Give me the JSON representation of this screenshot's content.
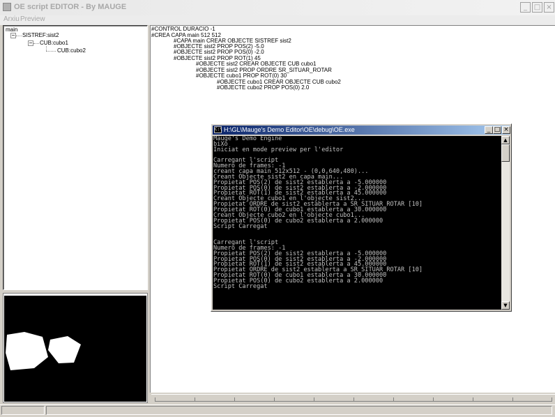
{
  "window": {
    "title": "OE script EDITOR - By MAUGE",
    "minimize_icon": "_",
    "maximize_icon": "□",
    "close_icon": "×"
  },
  "menu": [
    {
      "label": "Arxiu"
    },
    {
      "label": "Preview"
    }
  ],
  "tree": {
    "root": "main",
    "items": [
      {
        "label": "SISTREF:sist2",
        "expander": "−"
      },
      {
        "label": "CUB:cubo1",
        "expander": "−"
      },
      {
        "label": "CUB:cubo2"
      }
    ]
  },
  "editor": {
    "lines": [
      "#CONTROL DURACIO -1",
      "#CREA CAPA main 512 512",
      "#CAPA main CREAR OBJECTE SISTREF sist2",
      "#OBJECTE sist2 PROP POS(2) -5.0",
      "#OBJECTE sist2 PROP POS(0) -2.0",
      "#OBJECTE sist2 PROP ROT(1) 45",
      "#OBJECTE sist2 CREAR OBJECTE CUB cubo1",
      "#OBJECTE sist2 PROP ORDRE SR_SITUAR_ROTAR",
      "#OBJECTE cubo1 PROP ROT(0) 30",
      "#OBJECTE cubo1 CREAR OBJECTE CUB cubo2",
      "#OBJECTE cubo2 PROP POS(0) 2.0"
    ]
  },
  "console": {
    "title": "H:\\GL\\Mauge's Demo Editor\\OE\\debug\\OE.exe",
    "icon_label": "C:\\",
    "minimize_icon": "_",
    "maximize_icon": "□",
    "close_icon": "×",
    "scroll_up_icon": "▲",
    "scroll_down_icon": "▼",
    "lines": [
      "Mauge's Demo Engine",
      "biXo",
      "Iniciat en mode preview per l'editor",
      "",
      "Carregant l'script",
      "Numero de frames: -1",
      "creant capa main 512x512 - (0,0,640,480)...",
      "Creant Objecte sist2 en capa main...",
      "Propietat POS(2) de sist2 establerta a -5.000000",
      "Propietat POS(0) de sist2 establerta a -2.000000",
      "Propietat ROT(1) de sist2 establerta a 45.000000",
      "Creant Objecte cubo1 en l'objecte sist2...",
      "Propietat ORDRE de sist2 establerta a SR_SITUAR_ROTAR [10]",
      "Propietat ROT(0) de cubo1 establerta a 30.000000",
      "Creant Objecte cubo2 en l'objecte cubo1...",
      "Propietat POS(0) de cubo2 establerta a 2.000000",
      "Script Carregat",
      "",
      "",
      "Carregant l'script",
      "Numero de frames: -1",
      "Propietat POS(2) de sist2 establerta a -5.000000",
      "Propietat POS(0) de sist2 establerta a -2.000000",
      "Propietat ROT(1) de sist2 establerta a 45.000000",
      "Propietat ORDRE de sist2 establerta a SR_SITUAR_ROTAR [10]",
      "Propietat ROT(0) de cubo1 establerta a 30.000000",
      "Propietat POS(0) de cubo2 establerta a 2.000000",
      "Script Carregat"
    ]
  },
  "colors": {
    "console_title_start": "#0a246a",
    "console_title_end": "#a6caf0",
    "console_bg": "#000000",
    "console_text": "#c0c0c0",
    "preview_bg": "#000000",
    "preview_shapes": "#ffffff"
  }
}
